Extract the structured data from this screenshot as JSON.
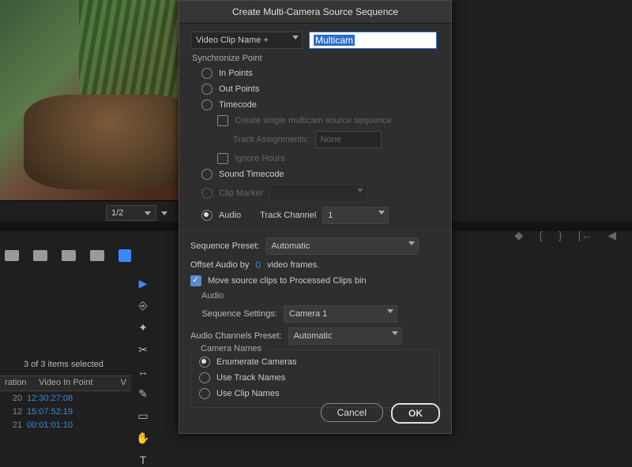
{
  "preview": {
    "zoom": "1/2"
  },
  "project": {
    "selection_info": "3 of 3 items selected",
    "columns": [
      "ration",
      "Video In Point",
      "V"
    ],
    "rows": [
      {
        "n": "20",
        "in": "12:30:27:08"
      },
      {
        "n": "12",
        "in": "15:07:52:19"
      },
      {
        "n": "21",
        "in": "00:01:01:10"
      }
    ]
  },
  "dialog": {
    "title": "Create Multi-Camera Source Sequence",
    "name_mode": "Video Clip Name +",
    "name_value": "Multicam",
    "sync": {
      "legend": "Synchronize Point",
      "in_points": "In Points",
      "out_points": "Out Points",
      "timecode": "Timecode",
      "create_single": "Create single multicam source sequence",
      "track_assign_label": "Track Assignments:",
      "track_assign_value": "None",
      "ignore_hours": "Ignore Hours",
      "sound_tc": "Sound Timecode",
      "clip_marker": "Clip Marker",
      "audio": "Audio",
      "track_channel_label": "Track Channel",
      "track_channel_value": "1"
    },
    "seq_preset_label": "Sequence Preset:",
    "seq_preset_value": "Automatic",
    "offset_pre": "Offset Audio by",
    "offset_val": "0",
    "offset_post": "video frames.",
    "move_clips": "Move source clips to Processed Clips bin",
    "audio_section": {
      "legend": "Audio",
      "seq_settings_label": "Sequence Settings:",
      "seq_settings_value": "Camera 1",
      "channels_label": "Audio Channels Preset:",
      "channels_value": "Automatic"
    },
    "cam_names": {
      "legend": "Camera Names",
      "enum": "Enumerate Cameras",
      "track": "Use Track Names",
      "clip": "Use Clip Names"
    },
    "cancel": "Cancel",
    "ok": "OK"
  }
}
